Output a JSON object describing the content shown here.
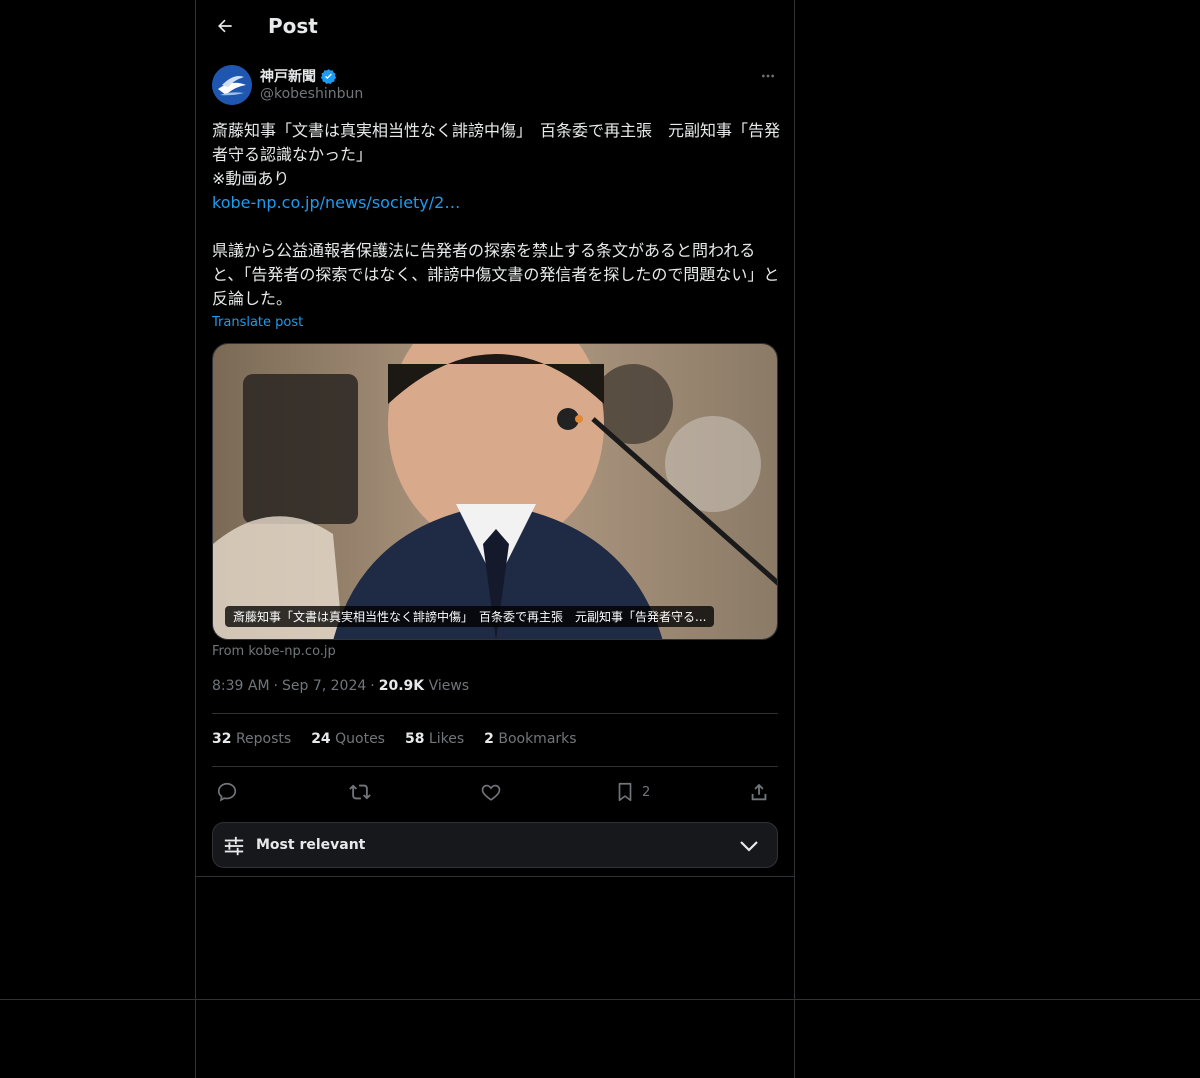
{
  "header": {
    "title": "Post"
  },
  "author": {
    "display_name": "神戸新聞",
    "handle": "@kobeshinbun",
    "verified_color": "#1d9bf0"
  },
  "post": {
    "text_line1": "斎藤知事「文書は真実相当性なく誹謗中傷」　百条委で再主張　元副知事「告発者守る認識なかった」",
    "text_line2": "※動画あり",
    "link_text": "kobe-np.co.jp/news/society/2…",
    "text_body": "県議から公益通報者保護法に告発者の探索を禁止する条文があると問われると、「告発者の探索ではなく、誹謗中傷文書の発信者を探したので問題ない」と反論した。",
    "translate_label": "Translate post"
  },
  "media": {
    "caption": "斎藤知事「文書は真実相当性なく誹謗中傷」　百条委で再主張　元副知事「告発者守る...",
    "source": "From kobe-np.co.jp"
  },
  "meta": {
    "time": "8:39 AM",
    "date": "Sep 7, 2024",
    "views_count": "20.9K",
    "views_label": "Views",
    "separator": "·"
  },
  "stats": [
    {
      "count": "32",
      "label": "Reposts"
    },
    {
      "count": "24",
      "label": "Quotes"
    },
    {
      "count": "58",
      "label": "Likes"
    },
    {
      "count": "2",
      "label": "Bookmarks"
    }
  ],
  "actions": {
    "bookmark_count": "2"
  },
  "sort": {
    "label": "Most relevant"
  },
  "colors": {
    "accent": "#1d9bf0",
    "muted": "#71767b",
    "border": "#2f3336",
    "text": "#e7e9ea"
  }
}
